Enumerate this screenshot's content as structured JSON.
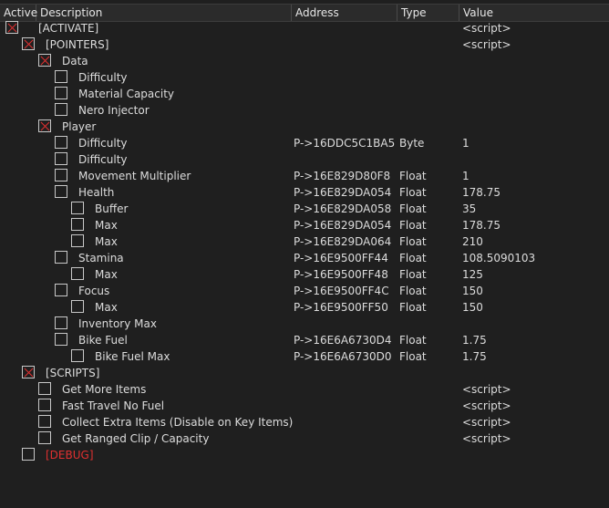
{
  "header": {
    "active": "Active",
    "description": "Description",
    "address": "Address",
    "type": "Type",
    "value": "Value"
  },
  "rows": [
    {
      "level": 0,
      "checked": true,
      "description": "[ACTIVATE]",
      "address": "",
      "type": "",
      "value": "<script>"
    },
    {
      "level": 1,
      "checked": true,
      "description": "[POINTERS]",
      "address": "",
      "type": "",
      "value": "<script>"
    },
    {
      "level": 2,
      "checked": true,
      "description": "Data",
      "address": "",
      "type": "",
      "value": ""
    },
    {
      "level": 3,
      "checked": false,
      "description": "Difficulty",
      "address": "",
      "type": "",
      "value": ""
    },
    {
      "level": 3,
      "checked": false,
      "description": "Material Capacity",
      "address": "",
      "type": "",
      "value": ""
    },
    {
      "level": 3,
      "checked": false,
      "description": "Nero Injector",
      "address": "",
      "type": "",
      "value": ""
    },
    {
      "level": 2,
      "checked": true,
      "description": "Player",
      "address": "",
      "type": "",
      "value": ""
    },
    {
      "level": 3,
      "checked": false,
      "description": "Difficulty",
      "address": "P->16DDC5C1BA5",
      "type": "Byte",
      "value": "1"
    },
    {
      "level": 3,
      "checked": false,
      "description": "Difficulty",
      "address": "",
      "type": "",
      "value": ""
    },
    {
      "level": 3,
      "checked": false,
      "description": "Movement Multiplier",
      "address": "P->16E829D80F8",
      "type": "Float",
      "value": "1"
    },
    {
      "level": 3,
      "checked": false,
      "description": "Health",
      "address": "P->16E829DA054",
      "type": "Float",
      "value": "178.75"
    },
    {
      "level": 4,
      "checked": false,
      "description": "Buffer",
      "address": "P->16E829DA058",
      "type": "Float",
      "value": "35"
    },
    {
      "level": 4,
      "checked": false,
      "description": "Max",
      "address": "P->16E829DA054",
      "type": "Float",
      "value": "178.75"
    },
    {
      "level": 4,
      "checked": false,
      "description": "Max",
      "address": "P->16E829DA064",
      "type": "Float",
      "value": "210"
    },
    {
      "level": 3,
      "checked": false,
      "description": "Stamina",
      "address": "P->16E9500FF44",
      "type": "Float",
      "value": "108.5090103"
    },
    {
      "level": 4,
      "checked": false,
      "description": "Max",
      "address": "P->16E9500FF48",
      "type": "Float",
      "value": "125"
    },
    {
      "level": 3,
      "checked": false,
      "description": "Focus",
      "address": "P->16E9500FF4C",
      "type": "Float",
      "value": "150"
    },
    {
      "level": 4,
      "checked": false,
      "description": "Max",
      "address": "P->16E9500FF50",
      "type": "Float",
      "value": "150"
    },
    {
      "level": 3,
      "checked": false,
      "description": "Inventory Max",
      "address": "",
      "type": "",
      "value": ""
    },
    {
      "level": 3,
      "checked": false,
      "description": "Bike Fuel",
      "address": "P->16E6A6730D4",
      "type": "Float",
      "value": "1.75"
    },
    {
      "level": 4,
      "checked": false,
      "description": "Bike Fuel Max",
      "address": "P->16E6A6730D0",
      "type": "Float",
      "value": "1.75"
    },
    {
      "level": 1,
      "checked": true,
      "description": "[SCRIPTS]",
      "address": "",
      "type": "",
      "value": ""
    },
    {
      "level": 2,
      "checked": false,
      "description": "Get More Items",
      "address": "",
      "type": "",
      "value": "<script>"
    },
    {
      "level": 2,
      "checked": false,
      "description": "Fast Travel No Fuel",
      "address": "",
      "type": "",
      "value": "<script>"
    },
    {
      "level": 2,
      "checked": false,
      "description": "Collect Extra Items (Disable on Key Items)",
      "address": "",
      "type": "",
      "value": "<script>"
    },
    {
      "level": 2,
      "checked": false,
      "description": "Get Ranged Clip / Capacity",
      "address": "",
      "type": "",
      "value": "<script>"
    },
    {
      "level": 1,
      "checked": false,
      "description": "[DEBUG]",
      "address": "",
      "type": "",
      "value": "",
      "color": "#e03030"
    }
  ],
  "colors": {
    "background": "#1f1f1f",
    "text": "#dcdcdc",
    "check_mark": "#e03030",
    "debug_label": "#e03030"
  },
  "icons": {
    "checked": "red-x-checkbox-icon",
    "unchecked": "empty-checkbox-icon"
  }
}
